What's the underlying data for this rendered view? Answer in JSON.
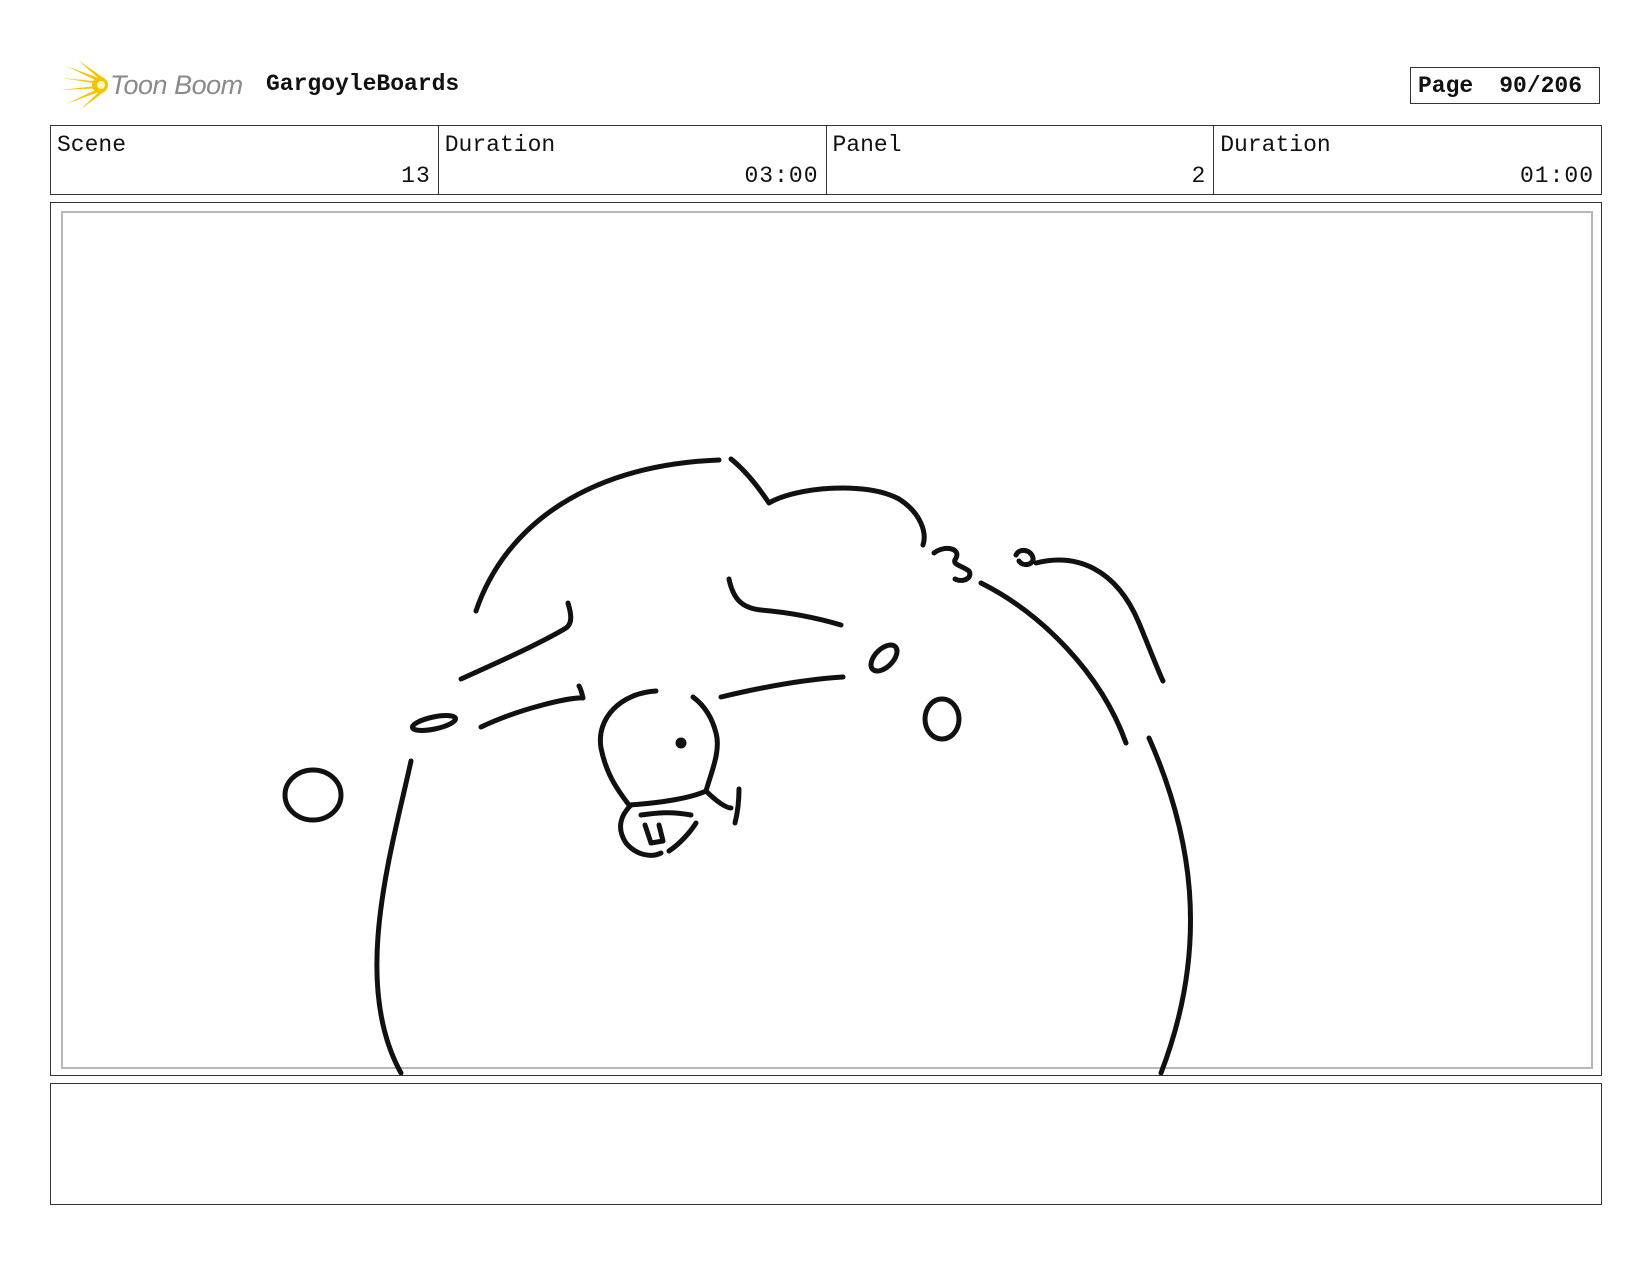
{
  "header": {
    "logo_text": "Toon Boom",
    "project_name": "GargoyleBoards",
    "page_label": "Page",
    "page_value": "90/206"
  },
  "info": {
    "scene_label": "Scene",
    "scene_value": "13",
    "scene_duration_label": "Duration",
    "scene_duration_value": "03:00",
    "panel_label": "Panel",
    "panel_value": "2",
    "panel_duration_label": "Duration",
    "panel_duration_value": "01:00"
  },
  "notes": {
    "text": ""
  },
  "colors": {
    "logo_yellow": "#f5c400",
    "logo_gray": "#8a8a8a",
    "ink": "#111111"
  }
}
